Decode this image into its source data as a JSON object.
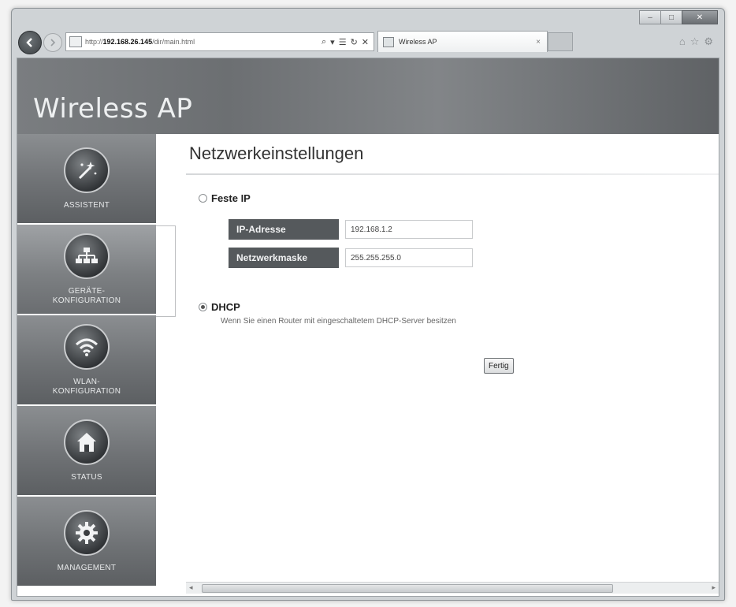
{
  "browser": {
    "address": {
      "url_prefix": "http://",
      "url_host": "192.168.26.145",
      "url_path": "/dir/main.html",
      "tools": [
        "⌕",
        "▾",
        "☰",
        "↻",
        "✕"
      ]
    },
    "tab": {
      "title": "Wireless AP",
      "close": "×"
    },
    "caption": {
      "minimize": "–",
      "maximize": "□",
      "close": "✕"
    },
    "right_icons": [
      "⌂",
      "☆",
      "⚙"
    ]
  },
  "app": {
    "title": "Wireless AP"
  },
  "sidebar": {
    "items": [
      {
        "label": "ASSISTENT",
        "icon": "wand-icon"
      },
      {
        "label": "GERÄTE-\nKONFIGURATION",
        "icon": "network-icon"
      },
      {
        "label": "WLAN-\nKONFIGURATION",
        "icon": "wifi-icon"
      },
      {
        "label": "STATUS",
        "icon": "home-icon"
      },
      {
        "label": "MANAGEMENT",
        "icon": "gear-icon"
      }
    ]
  },
  "main": {
    "title": "Netzwerkeinstellungen",
    "fixed_ip": {
      "label": "Feste IP",
      "ip_label": "IP-Adresse",
      "ip_value": "192.168.1.2",
      "mask_label": "Netzwerkmaske",
      "mask_value": "255.255.255.0"
    },
    "dhcp": {
      "label": "DHCP",
      "description": "Wenn Sie einen Router mit eingeschaltetem DHCP-Server besitzen"
    },
    "done_button": "Fertig"
  }
}
